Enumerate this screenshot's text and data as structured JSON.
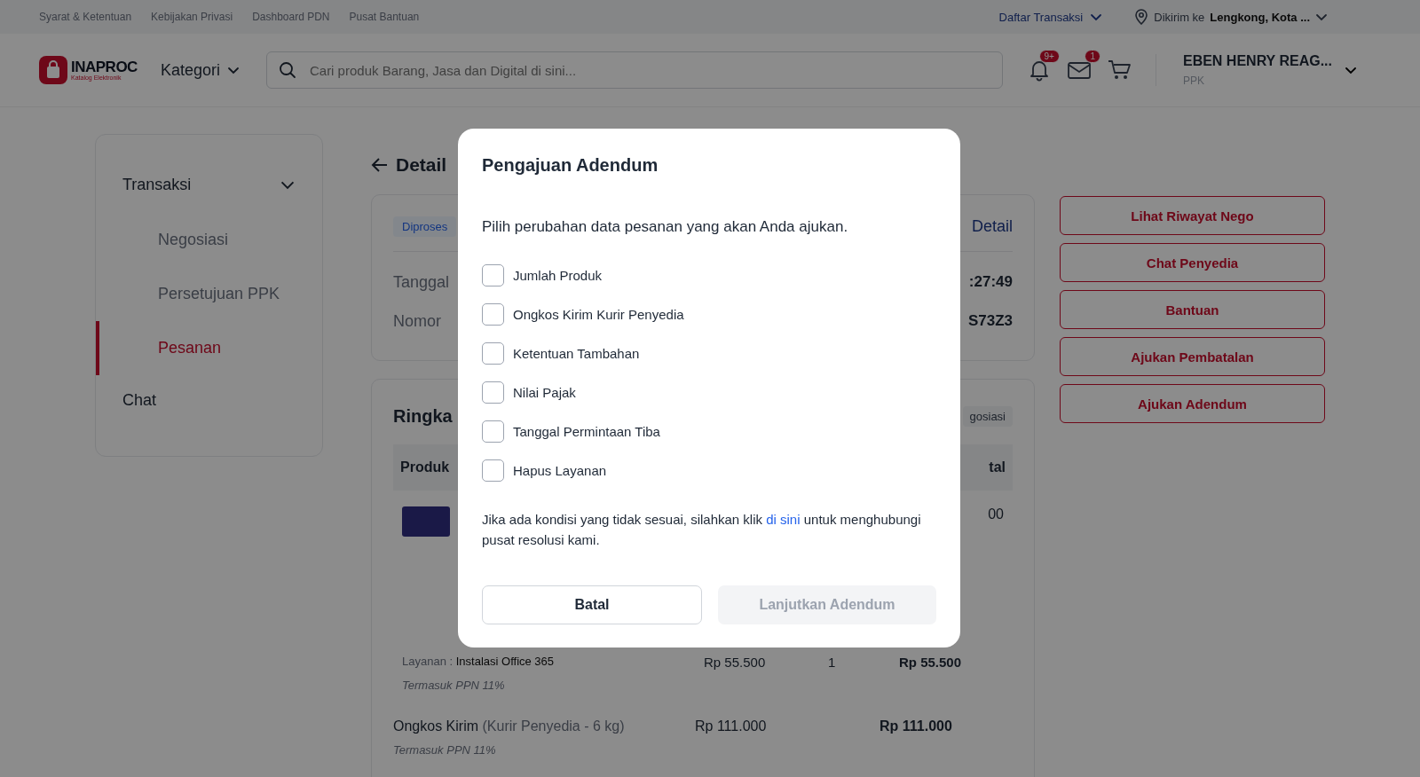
{
  "top_bar": {
    "links": [
      "Syarat & Ketentuan",
      "Kebijakan Privasi",
      "Dashboard PDN",
      "Pusat Bantuan"
    ],
    "transactions_menu": "Daftar Transaksi",
    "ship_label": "Dikirim ke",
    "ship_location": "Lengkong, Kota ..."
  },
  "header": {
    "logo": "INAPROC",
    "logo_subtitle": "Katalog Elektronik",
    "category_menu": "Kategori",
    "search": {
      "placeholder": "Cari produk Barang, Jasa dan Digital di sini..."
    },
    "notification_badge": "9+",
    "message_badge": "1",
    "user_name": "EBEN HENRY REAG...",
    "user_role": "PPK"
  },
  "sidebar": {
    "items": [
      {
        "label": "Transaksi",
        "expanded": true,
        "children": [
          {
            "label": "Negosiasi",
            "selected": false
          },
          {
            "label": "Persetujuan PPK",
            "selected": false
          },
          {
            "label": "Pesanan",
            "selected": true
          }
        ]
      },
      {
        "label": "Chat"
      }
    ]
  },
  "page_title": "Detail",
  "order_card": {
    "status": "Diproses",
    "detail_link": "Detail",
    "rows": [
      {
        "label": "Tanggal",
        "value": ":27:49"
      },
      {
        "label": "Nomor",
        "value": "S73Z3"
      }
    ]
  },
  "summary_card": {
    "title": "Ringka",
    "badge": "gosiasi",
    "columns": [
      "Produk",
      "tal"
    ],
    "product_total": "00",
    "service": {
      "label": "Layanan :",
      "name": "Instalasi Office 365",
      "price": "Rp 55.500",
      "qty": "1",
      "total": "Rp 55.500",
      "tax_note": "Termasuk PPN 11%"
    },
    "shipping": {
      "label": "Ongkos Kirim",
      "detail": "(Kurir Penyedia - 6 kg)",
      "price": "Rp 111.000",
      "total": "Rp 111.000",
      "tax_note": "Termasuk PPN 11%"
    }
  },
  "actions": [
    "Lihat Riwayat Nego",
    "Chat Penyedia",
    "Bantuan",
    "Ajukan Pembatalan",
    "Ajukan Adendum"
  ],
  "modal": {
    "title": "Pengajuan Adendum",
    "prompt": "Pilih perubahan data pesanan yang akan Anda ajukan.",
    "options": [
      {
        "label": "Jumlah Produk",
        "checked": false
      },
      {
        "label": "Ongkos Kirim Kurir Penyedia",
        "checked": false
      },
      {
        "label": "Ketentuan Tambahan",
        "checked": false
      },
      {
        "label": "Nilai Pajak",
        "checked": false
      },
      {
        "label": "Tanggal Permintaan Tiba",
        "checked": false
      },
      {
        "label": "Hapus Layanan",
        "checked": false
      }
    ],
    "note_before": "Jika ada kondisi yang tidak sesuai, silahkan klik",
    "note_link": "di sini",
    "note_after": "untuk menghubungi pusat resolusi kami.",
    "buttons": [
      {
        "label": "Batal",
        "kind": "secondary",
        "disabled": false
      },
      {
        "label": "Lanjutkan Adendum",
        "kind": "primary",
        "disabled": true
      }
    ]
  }
}
